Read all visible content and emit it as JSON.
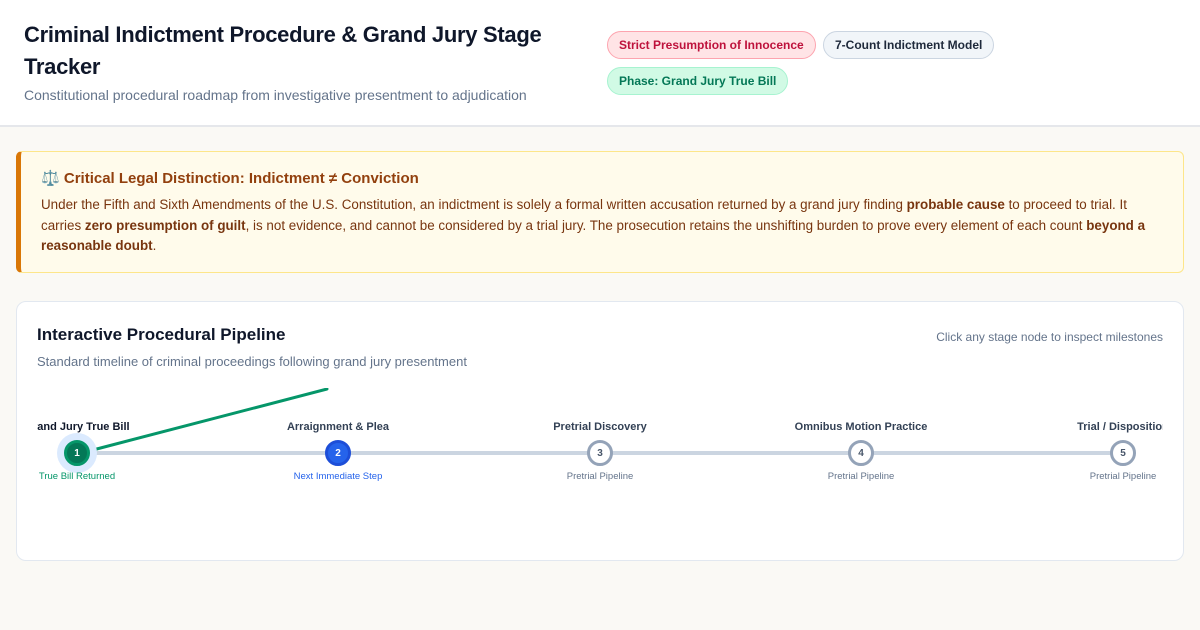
{
  "header": {
    "title": "Criminal Indictment Procedure & Grand Jury Stage Tracker",
    "subtitle": "Constitutional procedural roadmap from investigative presentment to adjudication",
    "badges": [
      {
        "label": "Strict Presumption of Innocence",
        "color": "#be123c"
      },
      {
        "label": "7-Count Indictment Model",
        "color": "#1e293b"
      },
      {
        "label": "Phase: Grand Jury True Bill",
        "color": "#047857"
      }
    ]
  },
  "alert": {
    "icon": "⚖️",
    "title": "Critical Legal Distinction: Indictment ≠ Conviction",
    "p1": "Under the Fifth and Sixth Amendments of the U.S. Constitution, an indictment is solely a formal written accusation returned by a grand jury finding ",
    "b1": "probable cause",
    "p2": " to proceed to trial. It carries ",
    "b2": "zero presumption of guilt",
    "p3": ", is not evidence, and cannot be considered by a trial jury. The prosecution retains the unshifting burden to prove every element of each count ",
    "b3": "beyond a reasonable doubt",
    "p4": "."
  },
  "pipeline": {
    "title": "Interactive Procedural Pipeline",
    "hint": "Click any stage node to inspect milestones",
    "subtitle": "Standard timeline of criminal proceedings following grand jury presentment",
    "stages": [
      {
        "number": "1",
        "label": "Grand Jury True Bill",
        "status": "True Bill Returned",
        "state": "done"
      },
      {
        "number": "2",
        "label": "Arraignment & Plea",
        "status": "Next Immediate Step",
        "state": "next"
      },
      {
        "number": "3",
        "label": "Pretrial Discovery",
        "status": "Pretrial Pipeline",
        "state": "pending"
      },
      {
        "number": "4",
        "label": "Omnibus Motion Practice",
        "status": "Pretrial Pipeline",
        "state": "pending"
      },
      {
        "number": "5",
        "label": "Trial / Disposition",
        "status": "Pretrial Pipeline",
        "state": "pending"
      }
    ]
  },
  "colors": {
    "done": "#047857",
    "next": "#2563eb",
    "pending": "#94a3b8",
    "warning_accent": "#d97706"
  }
}
